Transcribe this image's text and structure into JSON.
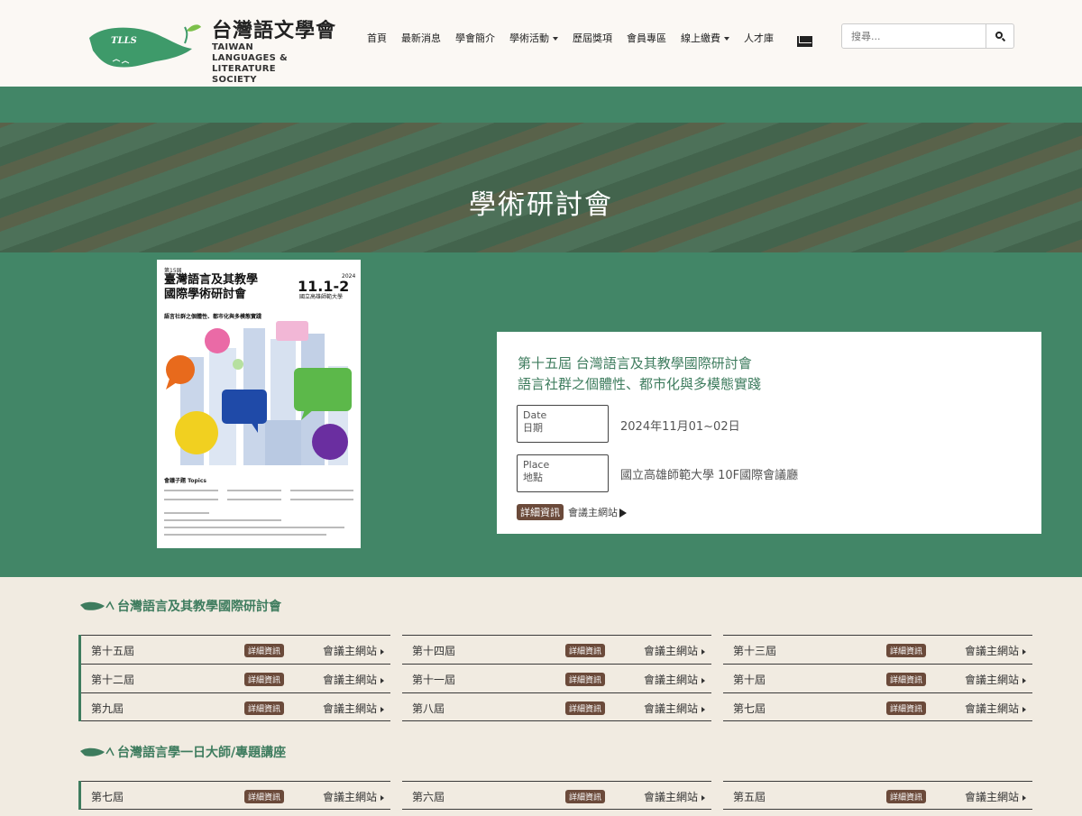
{
  "brand": {
    "name_zh": "台灣語文學會",
    "name_en_line1": "TAIWAN",
    "name_en_line2": "LANGUAGES & LITERATURE",
    "name_en_line3": "SOCIETY",
    "mark": "TLLS"
  },
  "nav": {
    "items": [
      {
        "label": "首頁"
      },
      {
        "label": "最新消息"
      },
      {
        "label": "學會簡介"
      },
      {
        "label": "學術活動",
        "dropdown": true
      },
      {
        "label": "歷屆獎項"
      },
      {
        "label": "會員專區"
      },
      {
        "label": "線上繳費",
        "dropdown": true
      },
      {
        "label": "人才庫"
      }
    ],
    "mail_icon": "envelope-icon"
  },
  "search": {
    "placeholder": "搜尋...",
    "icon": "search-icon"
  },
  "hero": {
    "title": "學術研討會"
  },
  "poster": {
    "edition": "第15屆",
    "title_line1": "臺灣語言及其教學",
    "title_line2": "國際學術研討會",
    "date": "11.1-2",
    "year": "2024",
    "venue": "國立高雄師範大學",
    "subtitle": "語言社群之個體性、都市化與多模態實踐",
    "topics": "會議子題 Topics"
  },
  "featured": {
    "title_line1": "第十五屆 台灣語言及其教學國際研討會",
    "title_line2": "語言社群之個體性、都市化與多模態實踐",
    "date_label_en": "Date",
    "date_label_zh": "日期",
    "date_value": "2024年11月01~02日",
    "place_label_en": "Place",
    "place_label_zh": "地點",
    "place_value": "國立高雄師範大學 10F國際會議廳",
    "detail_label": "詳細資訊",
    "site_label": "會議主網站"
  },
  "sections": [
    {
      "title": "台灣語言及其教學國際研討會",
      "rows": [
        [
          "第十五屆",
          "第十四屆",
          "第十三屆"
        ],
        [
          "第十二屆",
          "第十一屆",
          "第十屆"
        ],
        [
          "第九屆",
          "第八屆",
          "第七屆"
        ]
      ]
    },
    {
      "title": "台灣語言學一日大師/專題講座",
      "rows": [
        [
          "第七屆",
          "第六屆",
          "第五屆"
        ]
      ]
    }
  ],
  "cell_detail_label": "詳細資訊",
  "cell_site_label": "會議主網站",
  "colors": {
    "green": "#428667",
    "title_green": "#3e7c5e",
    "badge_brown": "#6b4a3a",
    "beige": "#f1ebe1"
  }
}
